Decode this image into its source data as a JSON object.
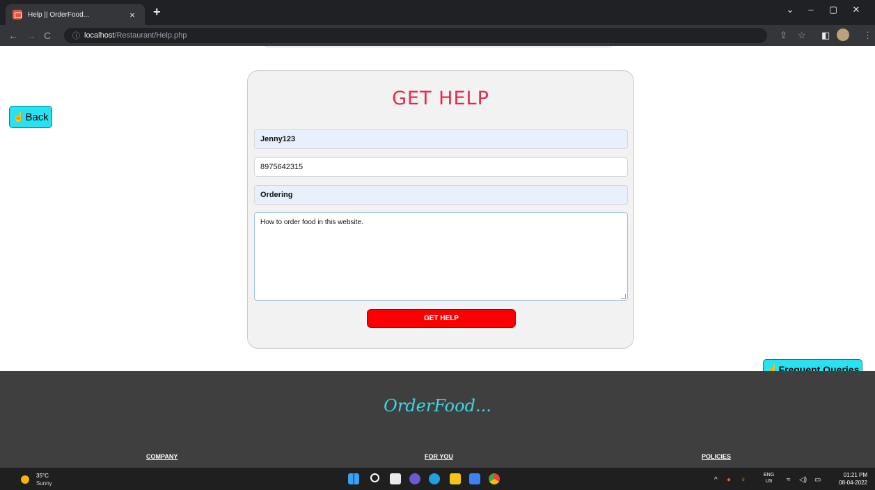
{
  "browser": {
    "tab_title": "Help || OrderFood...",
    "tab_close": "×",
    "new_tab": "+",
    "url_host": "localhost",
    "url_path": "/Restaurant/Help.php",
    "window_controls": [
      "⌄",
      "–",
      "▢",
      "✕"
    ]
  },
  "page": {
    "back_label": "Back",
    "form": {
      "title": "GET HELP",
      "username_value": "Jenny123",
      "phone_value": "8975642315",
      "topic_value": "Ordering",
      "message_value": "How to order food in this website.",
      "submit_label": "GET HELP"
    },
    "frequent_queries_label": "Frequent Queries"
  },
  "footer": {
    "brand": "OrderFood...",
    "columns": [
      "COMPANY",
      "FOR YOU",
      "POLICIES"
    ]
  },
  "taskbar": {
    "temperature": "35°C",
    "condition": "Sunny",
    "lang_top": "ENG",
    "lang_bottom": "US",
    "time": "01:21 PM",
    "date": "08-04-2022"
  },
  "colors": {
    "accent_cyan": "#27e3f2",
    "title_red": "#e8284f",
    "submit_red": "#fb0000",
    "footer_bg": "#3f3f3f"
  }
}
